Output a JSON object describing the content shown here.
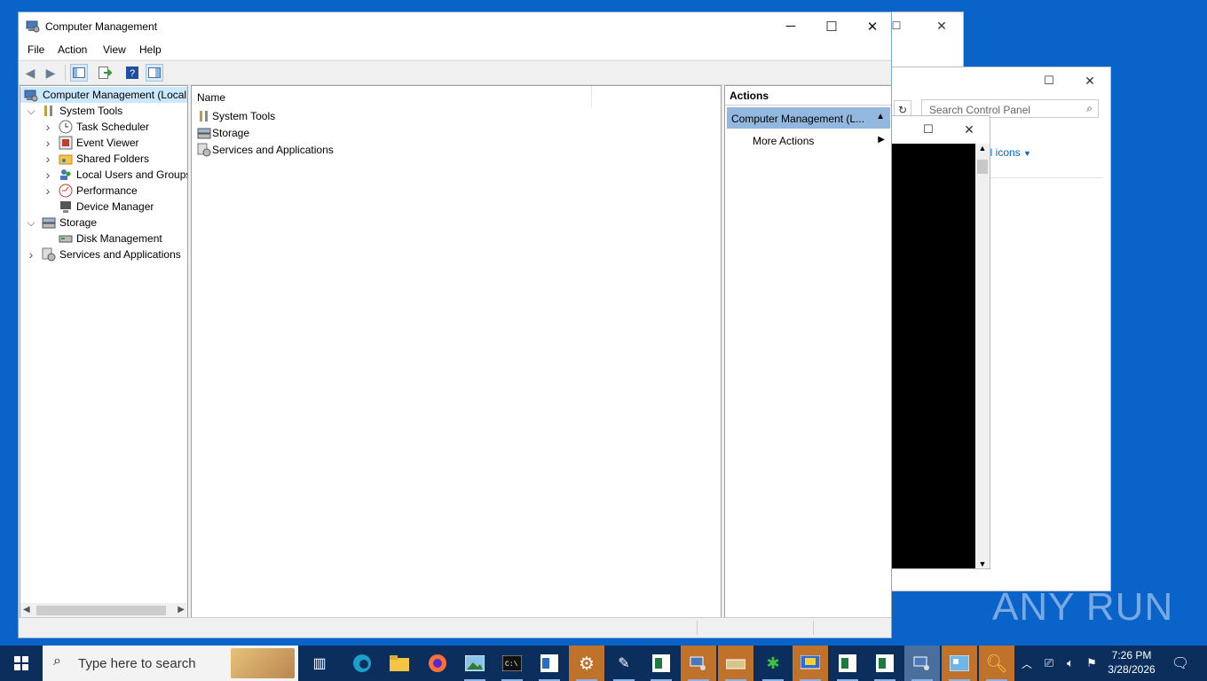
{
  "main_window": {
    "title": "Computer Management",
    "menu": [
      "File",
      "Action",
      "View",
      "Help"
    ],
    "tree": [
      {
        "label": "Computer Management (Local",
        "level": 0,
        "expander": "",
        "selected": true,
        "icon": "computer-management-icon"
      },
      {
        "label": "System Tools",
        "level": 1,
        "expander": "expanded",
        "icon": "tools-icon"
      },
      {
        "label": "Task Scheduler",
        "level": 2,
        "expander": "collapsed",
        "icon": "clock-icon"
      },
      {
        "label": "Event Viewer",
        "level": 2,
        "expander": "collapsed",
        "icon": "event-viewer-icon"
      },
      {
        "label": "Shared Folders",
        "level": 2,
        "expander": "collapsed",
        "icon": "shared-folder-icon"
      },
      {
        "label": "Local Users and Groups",
        "level": 2,
        "expander": "collapsed",
        "icon": "users-icon"
      },
      {
        "label": "Performance",
        "level": 2,
        "expander": "collapsed",
        "icon": "performance-icon"
      },
      {
        "label": "Device Manager",
        "level": 2,
        "expander": "",
        "icon": "device-manager-icon"
      },
      {
        "label": "Storage",
        "level": 1,
        "expander": "expanded",
        "icon": "storage-icon"
      },
      {
        "label": "Disk Management",
        "level": 2,
        "expander": "",
        "icon": "disk-icon"
      },
      {
        "label": "Services and Applications",
        "level": 1,
        "expander": "collapsed",
        "icon": "services-icon"
      }
    ],
    "list": {
      "column_header": "Name",
      "items": [
        {
          "label": "System Tools",
          "icon": "tools-icon"
        },
        {
          "label": "Storage",
          "icon": "storage-icon"
        },
        {
          "label": "Services and Applications",
          "icon": "services-icon"
        }
      ]
    },
    "actions": {
      "header": "Actions",
      "section": "Computer Management (L...",
      "items": [
        "More Actions"
      ]
    }
  },
  "control_panel": {
    "search_placeholder": "Search Control Panel",
    "view_link": "ll icons"
  },
  "watermark": "ANY RUN",
  "taskbar": {
    "search_placeholder": "Type here to search",
    "time": "7:26 PM",
    "date": "3/28/2026"
  },
  "colors": {
    "desktop": "#0a63c9",
    "selection": "#cce8ff",
    "actions_header": "#93b8e0",
    "taskbar": "#0b2e5c"
  }
}
